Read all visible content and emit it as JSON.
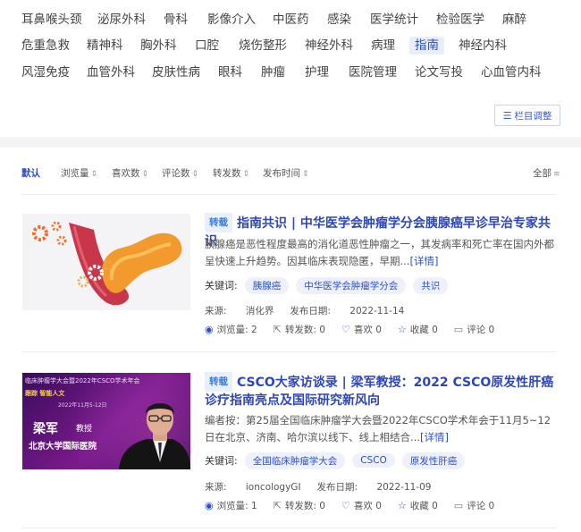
{
  "categories": {
    "row1": [
      "耳鼻喉头颈",
      "泌尿外科",
      "骨科",
      "影像介入",
      "中医药",
      "感染",
      "医学统计",
      "检验医学",
      "麻醉"
    ],
    "row2": [
      "危重急救",
      "精神科",
      "胸外科",
      "口腔",
      "烧伤整形",
      "神经外科",
      "病理",
      "指南",
      "神经内科"
    ],
    "row3": [
      "风湿免疫",
      "血管外科",
      "皮肤性病",
      "眼科",
      "肿瘤",
      "护理",
      "医院管理",
      "论文写投",
      "心血管内科"
    ],
    "active": "指南"
  },
  "adjust_button": "栏目调整",
  "sort": {
    "default": "默认",
    "views": "浏览量",
    "likes": "喜欢数",
    "comments": "评论数",
    "shares": "转发数",
    "date": "发布时间",
    "all": "全部"
  },
  "labels": {
    "keywords": "关键词:",
    "source": "来源:",
    "date": "发布日期:",
    "views": "浏览量:",
    "shares": "转发数:",
    "likes": "喜欢",
    "collect": "收藏",
    "comment": "评论",
    "more": "[详情]"
  },
  "articles": [
    {
      "tag": "转载",
      "title": "指南共识 | 中华医学会肿瘤学分会胰腺癌早诊早治专家共识",
      "excerpt": "胰腺癌是恶性程度最高的消化道恶性肿瘤之一，其发病率和死亡率在国内外都呈快速上升趋势。因其临床表现隐匿，早期...",
      "keywords": [
        "胰腺癌",
        "中华医学会肿瘤学分会",
        "共识"
      ],
      "source": "消化界",
      "date": "2022-11-14",
      "views": "2",
      "shares": "0",
      "likes": "0",
      "collects": "0",
      "comments": "0"
    },
    {
      "tag": "转载",
      "title": "CSCO大家访谈录 | 梁军教授：2022 CSCO原发性肝癌诊疗指南亮点及国际研究新风向",
      "excerpt": "编者按：第25届全国临床肿瘤学大会暨2022年CSCO学术年会于11月5~12日在北京、济南、哈尔滨以线下、线上相结合...",
      "keywords": [
        "全国临床肿瘤学大会",
        "CSCO",
        "原发性肝癌"
      ],
      "source": "ioncologyGI",
      "date": "2022-11-09",
      "views": "1",
      "shares": "0",
      "likes": "0",
      "collects": "0",
      "comments": "0",
      "thumb": {
        "header": "临床肿瘤学大会暨2022年CSCO学术年会",
        "badge": "跟踪 智能人文",
        "dates": "2022年11月5-12日",
        "name": "梁军",
        "role": "教授",
        "hospital": "北京大学国际医院"
      }
    }
  ]
}
